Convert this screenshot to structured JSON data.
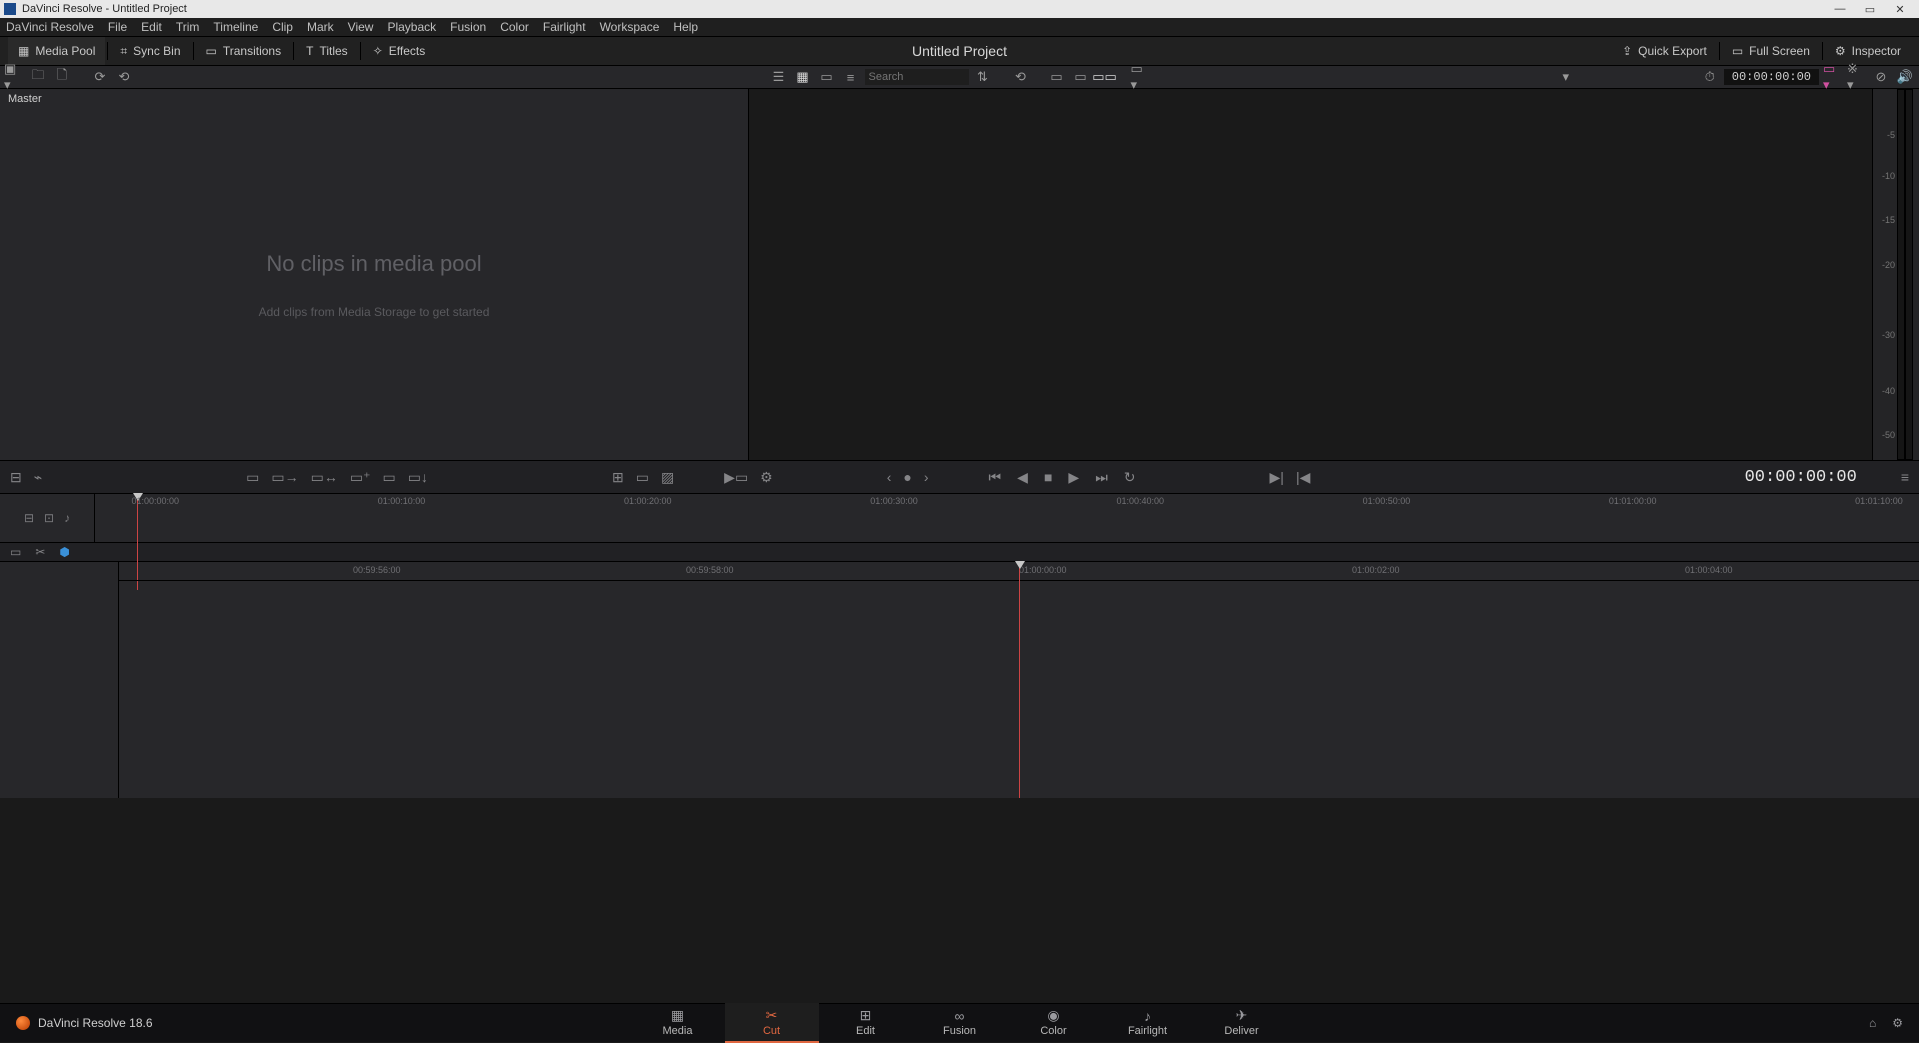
{
  "window": {
    "title": "DaVinci Resolve - Untitled Project"
  },
  "menu": [
    "DaVinci Resolve",
    "File",
    "Edit",
    "Trim",
    "Timeline",
    "Clip",
    "Mark",
    "View",
    "Playback",
    "Fusion",
    "Color",
    "Fairlight",
    "Workspace",
    "Help"
  ],
  "tabs": {
    "media_pool": "Media Pool",
    "sync_bin": "Sync Bin",
    "transitions": "Transitions",
    "titles": "Titles",
    "effects": "Effects",
    "quick_export": "Quick Export",
    "full_screen": "Full Screen",
    "inspector": "Inspector"
  },
  "project_title": "Untitled Project",
  "toolrow": {
    "search_placeholder": "Search",
    "viewer_tc": "00:00:00:00"
  },
  "media_pool": {
    "master": "Master",
    "empty_title": "No clips in media pool",
    "empty_sub": "Add clips from Media Storage to get started"
  },
  "audio_scale": [
    "-5",
    "-10",
    "-15",
    "-20",
    "-30",
    "-40",
    "-50"
  ],
  "transport_tc": "00:00:00:00",
  "upper_ruler": [
    {
      "label": "01:00:00:00",
      "pct": 2
    },
    {
      "label": "01:00:10:00",
      "pct": 15.5
    },
    {
      "label": "01:00:20:00",
      "pct": 29
    },
    {
      "label": "01:00:30:00",
      "pct": 42.5
    },
    {
      "label": "01:00:40:00",
      "pct": 56
    },
    {
      "label": "01:00:50:00",
      "pct": 69.5
    },
    {
      "label": "01:01:00:00",
      "pct": 83
    },
    {
      "label": "01:01:10:00",
      "pct": 96.5
    }
  ],
  "lower_ruler": [
    {
      "label": "00:59:56:00",
      "pct": 13
    },
    {
      "label": "00:59:58:00",
      "pct": 31.5
    },
    {
      "label": "01:00:00:00",
      "pct": 50
    },
    {
      "label": "01:00:02:00",
      "pct": 68.5
    },
    {
      "label": "01:00:04:00",
      "pct": 87
    }
  ],
  "pages": [
    "Media",
    "Cut",
    "Edit",
    "Fusion",
    "Color",
    "Fairlight",
    "Deliver"
  ],
  "active_page": "Cut",
  "brand": "DaVinci Resolve 18.6"
}
